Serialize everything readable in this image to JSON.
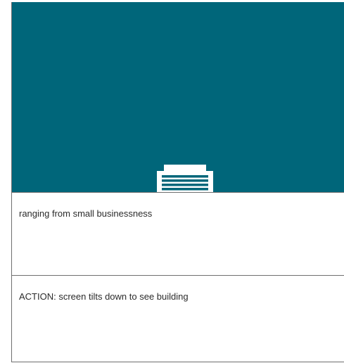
{
  "colors": {
    "frame_background": "#00667a",
    "icon_fill": "#ffffff",
    "divider": "#6f6f6f",
    "text": "#2b2b2b"
  },
  "frame": {
    "icon_name": "building-icon"
  },
  "notes": [
    {
      "text": "ranging from small businessness"
    },
    {
      "text": "ACTION: screen tilts down to see building"
    }
  ]
}
